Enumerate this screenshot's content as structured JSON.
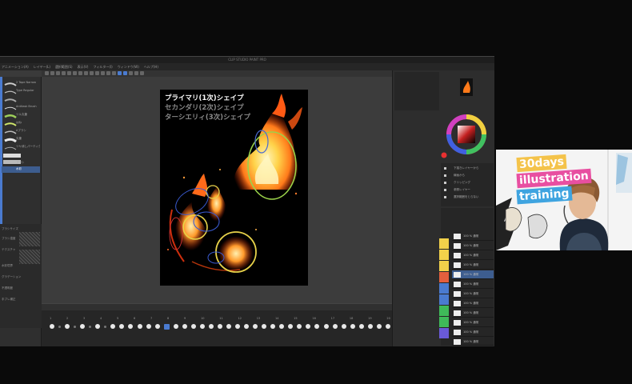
{
  "app": {
    "title": "CLIP STUDIO PAINT PRO",
    "menu": [
      "アニメーション(A)",
      "レイヤー(L)",
      "選択範囲(S)",
      "表示(V)",
      "フィルター(I)",
      "ウィンドウ(W)",
      "ヘルプ(H)"
    ]
  },
  "left_panel": {
    "brushes": [
      "2 Tape Narrow",
      "Type Regular",
      "Antitask Brush",
      "ツル丸筆",
      "はね",
      "Aブラシ",
      "丸筆",
      "ツヤ消しパーティクル",
      "ブラシ",
      "水彩"
    ],
    "properties": [
      "ブラシサイズ",
      "ブラシ濃度",
      "テクスチャ",
      "水彩境界",
      "グラデーション",
      "不透明度",
      "手ブレ補正"
    ]
  },
  "canvas": {
    "captions": {
      "primary": "プライマリ(1次)シェイプ",
      "secondary": "セカンダリ(2次)シェイプ",
      "tertiary": "ターシエリィ(3次)シェイプ"
    }
  },
  "timeline": {
    "frame_numbers": [
      "1",
      "2",
      "3",
      "4",
      "5",
      "6",
      "7",
      "8",
      "9",
      "10",
      "11",
      "12",
      "13",
      "14",
      "15",
      "16",
      "17",
      "18",
      "19",
      "20"
    ],
    "current_frame": 14
  },
  "layer_properties": {
    "rows": [
      "下描きレイヤーから",
      "線画から",
      "クリッピング",
      "参照レイヤー",
      "選択範囲をとらない"
    ]
  },
  "layers": {
    "rows": [
      "100 % 通常",
      "100 % 通常",
      "100 % 通常",
      "100 % 通常",
      "100 % 通常",
      "100 % 通常",
      "100 % 通常",
      "100 % 通常",
      "100 % 通常",
      "100 % 通常",
      "100 % 通常",
      "100 % 通常"
    ],
    "selected_index": 4,
    "color_strip": [
      "#f2d14a",
      "#f2d14a",
      "#f2d14a",
      "#e35f3d",
      "#4a7bd0",
      "#4a7bd0",
      "#3fba59",
      "#3fba59",
      "#6a5ad8"
    ]
  },
  "webcam": {
    "banner_line1": "30days",
    "banner_line2": "illustration",
    "banner_line3": "training"
  },
  "colors": {
    "accent": "#4a7bd0",
    "flame_core": "#ffd34a",
    "flame_outer": "#ff5a14"
  }
}
